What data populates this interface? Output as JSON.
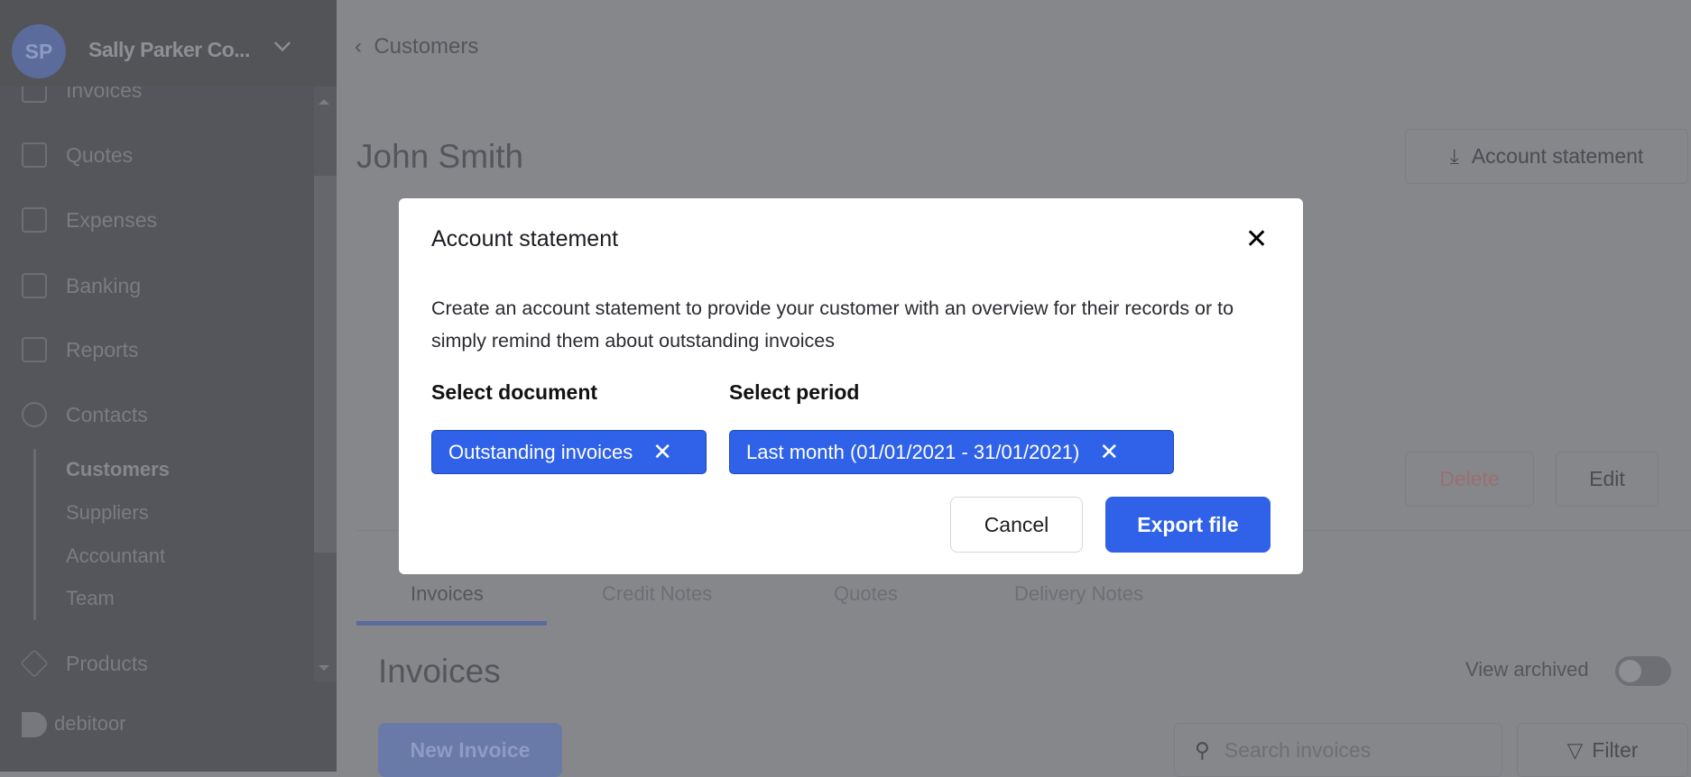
{
  "sidebar": {
    "org_initials": "SP",
    "org_name": "Sally Parker Co...",
    "items": [
      {
        "label": "Invoices"
      },
      {
        "label": "Quotes"
      },
      {
        "label": "Expenses"
      },
      {
        "label": "Banking"
      },
      {
        "label": "Reports"
      },
      {
        "label": "Contacts"
      }
    ],
    "contacts_sub": [
      {
        "label": "Customers"
      },
      {
        "label": "Suppliers"
      },
      {
        "label": "Accountant"
      },
      {
        "label": "Team"
      }
    ],
    "products": "Products",
    "brand": "debitoor"
  },
  "header": {
    "breadcrumb": "Customers",
    "title": "John Smith",
    "account_statement": "Account statement",
    "delete": "Delete",
    "edit": "Edit"
  },
  "tabs": [
    {
      "label": "Invoices"
    },
    {
      "label": "Credit Notes"
    },
    {
      "label": "Quotes"
    },
    {
      "label": "Delivery Notes"
    }
  ],
  "invoices": {
    "heading": "Invoices",
    "view_archived": "View archived",
    "new_invoice": "New Invoice",
    "search_placeholder": "Search invoices",
    "filter": "Filter"
  },
  "modal": {
    "title": "Account statement",
    "description": "Create an account statement to provide your customer with an overview for their records or to simply remind them about outstanding invoices",
    "select_document_label": "Select document",
    "select_period_label": "Select period",
    "document_value": "Outstanding invoices",
    "period_value": "Last month (01/01/2021 - 31/01/2021)",
    "cancel": "Cancel",
    "export": "Export file"
  },
  "colors": {
    "accent": "#2f62e8"
  }
}
